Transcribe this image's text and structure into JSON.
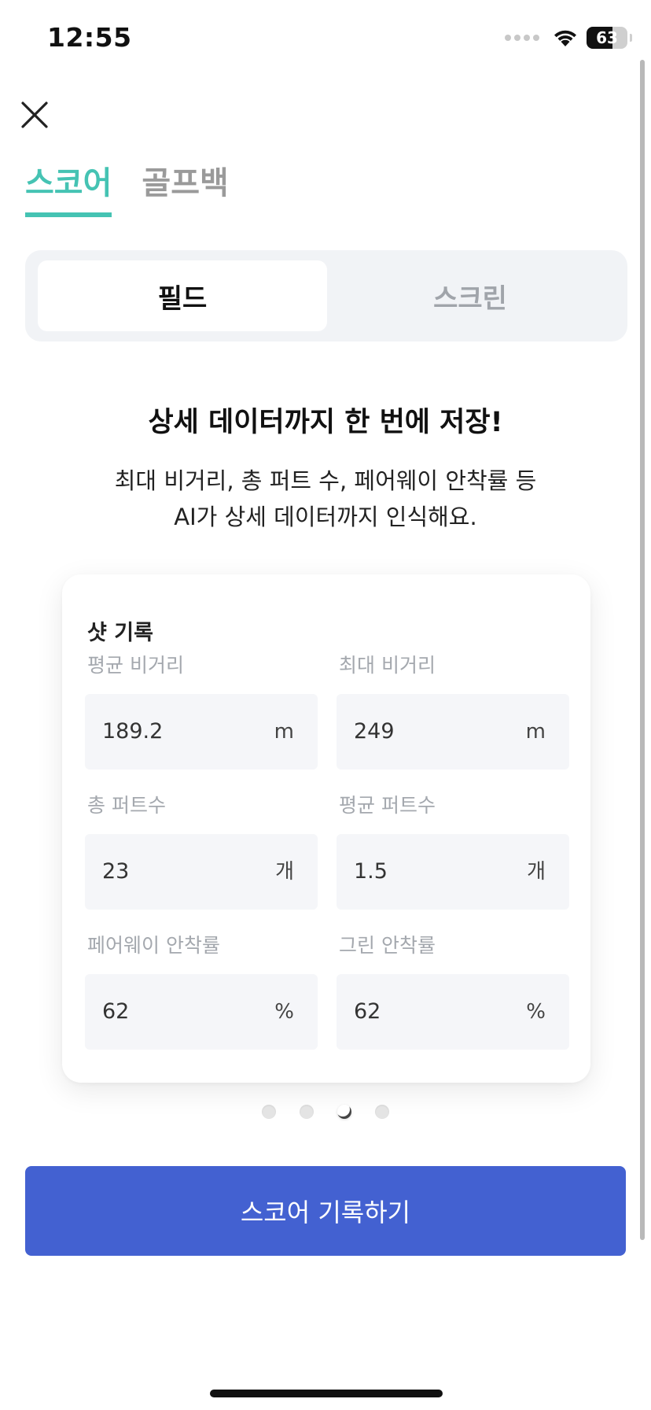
{
  "status_bar": {
    "time": "12:55",
    "battery_level": "63"
  },
  "top_tabs": [
    {
      "label": "스코어",
      "active": true
    },
    {
      "label": "골프백",
      "active": false
    }
  ],
  "segments": [
    {
      "label": "필드",
      "active": true
    },
    {
      "label": "스크린",
      "active": false
    }
  ],
  "headline": "상세 데이터까지 한 번에 저장!",
  "description": {
    "line1": "최대 비거리, 총 퍼트 수, 페어웨이 안착률 등",
    "line2": "AI가 상세 데이터까지 인식해요."
  },
  "card": {
    "title": "샷 기록",
    "fields": [
      {
        "label": "평균 비거리",
        "value": "189.2",
        "unit": "m"
      },
      {
        "label": "최대 비거리",
        "value": "249",
        "unit": "m"
      },
      {
        "label": "총 퍼트수",
        "value": "23",
        "unit": "개"
      },
      {
        "label": "평균 퍼트수",
        "value": "1.5",
        "unit": "개"
      },
      {
        "label": "페어웨이 안착률",
        "value": "62",
        "unit": "%"
      },
      {
        "label": "그린 안착률",
        "value": "62",
        "unit": "%"
      }
    ]
  },
  "pager": {
    "total": 4,
    "active_index": 2
  },
  "cta_label": "스코어 기록하기",
  "colors": {
    "accent_teal": "#45c3b3",
    "cta_blue": "#4361d1"
  }
}
